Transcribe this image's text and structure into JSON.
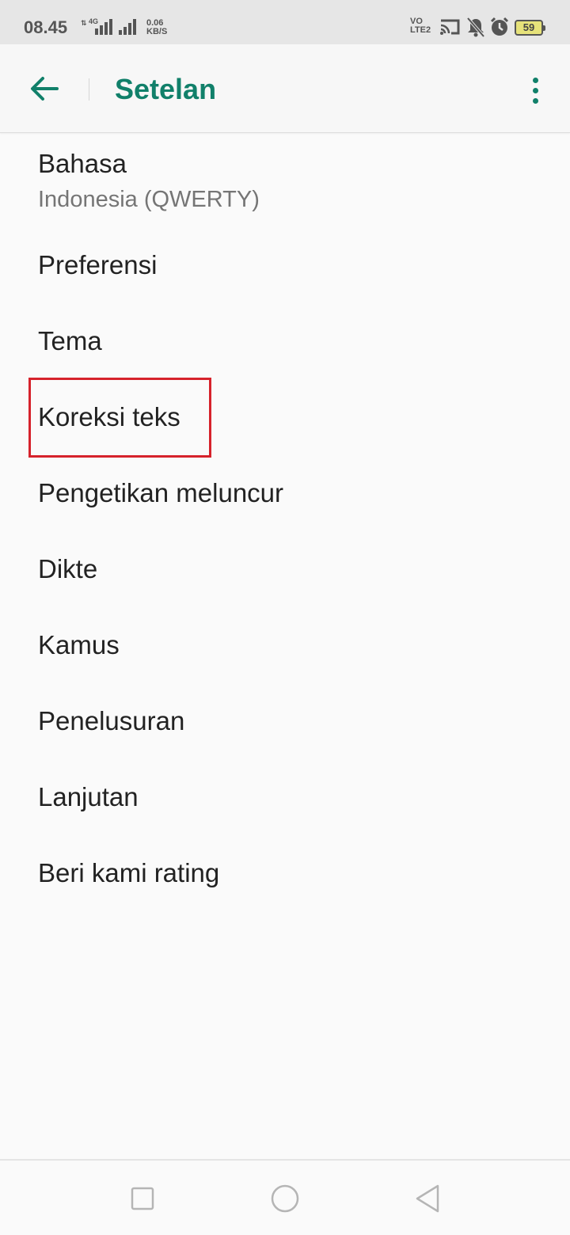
{
  "status_bar": {
    "time": "08.45",
    "network_type": "4G",
    "speed_value": "0.06",
    "speed_unit": "KB/S",
    "volte_top": "VO",
    "volte_bottom": "LTE2",
    "battery": "59"
  },
  "app_bar": {
    "title": "Setelan",
    "accent_color": "#11806a"
  },
  "settings": {
    "items": [
      {
        "title": "Bahasa",
        "subtitle": "Indonesia (QWERTY)"
      },
      {
        "title": "Preferensi"
      },
      {
        "title": "Tema"
      },
      {
        "title": "Koreksi teks",
        "highlighted": true
      },
      {
        "title": "Pengetikan meluncur"
      },
      {
        "title": "Dikte"
      },
      {
        "title": "Kamus"
      },
      {
        "title": "Penelusuran"
      },
      {
        "title": "Lanjutan"
      },
      {
        "title": "Beri kami rating"
      }
    ]
  },
  "highlight": {
    "color": "#d6222b"
  },
  "icons": {
    "back": "arrow-left-icon",
    "overflow": "more-vertical-icon",
    "nav_recents": "square-icon",
    "nav_home": "circle-icon",
    "nav_back": "triangle-back-icon"
  }
}
